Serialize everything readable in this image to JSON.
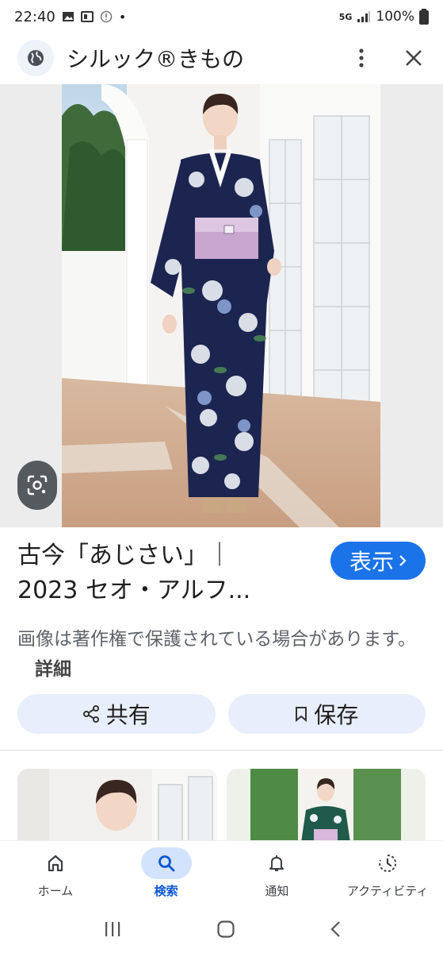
{
  "status": {
    "time": "22:40",
    "network": "5G",
    "battery": "100%"
  },
  "header": {
    "title": "シルック®きもの"
  },
  "result": {
    "title": "古今「あじさい」｜\n2023 セオ・アルフ...",
    "visit_label": "表示",
    "copyright": "画像は著作権で保護されている場合があります。",
    "details_label": "詳細"
  },
  "actions": {
    "share_label": "共有",
    "save_label": "保存"
  },
  "bottom_nav": {
    "items": [
      {
        "label": "ホーム",
        "icon": "home-icon"
      },
      {
        "label": "検索",
        "icon": "search-icon"
      },
      {
        "label": "通知",
        "icon": "bell-icon"
      },
      {
        "label": "アクティビティ",
        "icon": "activity-icon"
      }
    ],
    "active_index": 1
  },
  "colors": {
    "accent": "#1a73e8",
    "pill_bg": "#e8eefb",
    "active_nav_bg": "#d3e3fd"
  }
}
